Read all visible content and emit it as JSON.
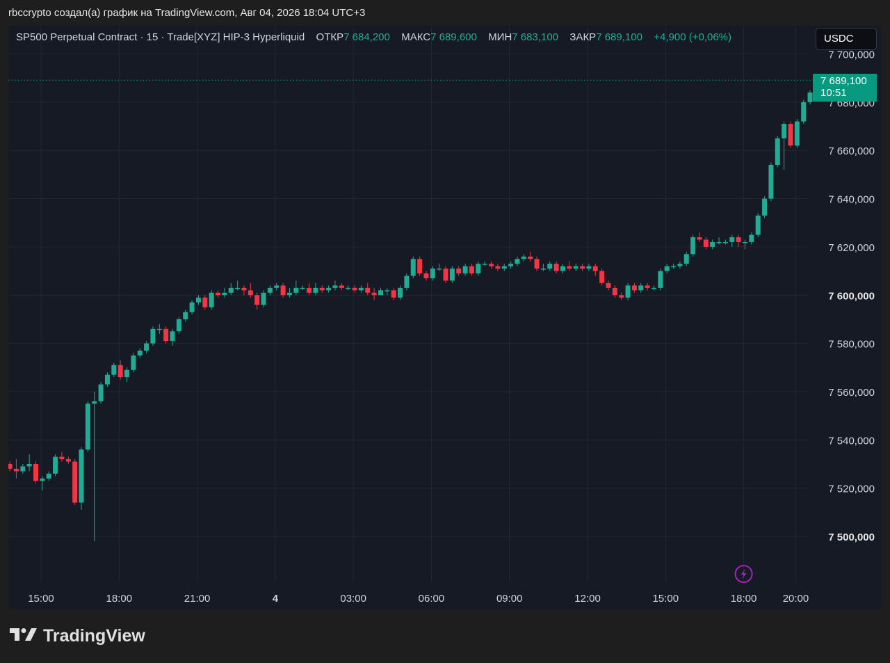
{
  "header": {
    "publisher_line": "rbccrypto создал(а) график на TradingView.com, Авг 04, 2026 18:04 UTC+3"
  },
  "legend": {
    "symbol": "SP500 Perpetual Contract · 15 · Trade[XYZ] HIP-3 Hyperliquid",
    "open_label": "ОТКР",
    "open_value": "7 684,200",
    "high_label": "МАКС",
    "high_value": "7 689,600",
    "low_label": "МИН",
    "low_value": "7 683,100",
    "close_label": "ЗАКР",
    "close_value": "7 689,100",
    "change": "+4,900 (+0,06%)"
  },
  "currency_button": {
    "label": "USDC"
  },
  "price_tag": {
    "price": "7 689,100",
    "countdown": "10:51"
  },
  "brand": {
    "name": "TradingView"
  },
  "colors": {
    "up": "#22ab94",
    "down": "#f23645",
    "background": "#161a25",
    "grid": "#232734",
    "tag": "#089981",
    "lightning": "#9c27b0"
  },
  "icons": {
    "lightning": "lightning-icon",
    "logo": "tradingview-logo-icon"
  },
  "chart_data": {
    "type": "candlestick",
    "title": "SP500 Perpetual Contract · 15 · Trade[XYZ] HIP-3 Hyperliquid",
    "interval": "15",
    "current_price": 7689.1,
    "ylim": [
      7487,
      7707
    ],
    "y_ticks": [
      {
        "value": 7700,
        "label": "7 700,000",
        "bold": false
      },
      {
        "value": 7680,
        "label": "7 680,000",
        "bold": false
      },
      {
        "value": 7660,
        "label": "7 660,000",
        "bold": false
      },
      {
        "value": 7640,
        "label": "7 640,000",
        "bold": false
      },
      {
        "value": 7620,
        "label": "7 620,000",
        "bold": false
      },
      {
        "value": 7600,
        "label": "7 600,000",
        "bold": true
      },
      {
        "value": 7580,
        "label": "7 580,000",
        "bold": false
      },
      {
        "value": 7560,
        "label": "7 560,000",
        "bold": false
      },
      {
        "value": 7540,
        "label": "7 540,000",
        "bold": false
      },
      {
        "value": 7520,
        "label": "7 520,000",
        "bold": false
      },
      {
        "value": 7500,
        "label": "7 500,000",
        "bold": true
      }
    ],
    "x_range_hours": [
      13.78,
      20.33
    ],
    "x_ticks": [
      {
        "hour": 15,
        "label": "15:00",
        "bold": false
      },
      {
        "hour": 18,
        "label": "18:00",
        "bold": false
      },
      {
        "hour": 21,
        "label": "21:00",
        "bold": false
      },
      {
        "hour": 24,
        "label": "4",
        "bold": true
      },
      {
        "hour": 27,
        "label": "03:00",
        "bold": false
      },
      {
        "hour": 30,
        "label": "06:00",
        "bold": false
      },
      {
        "hour": 33,
        "label": "09:00",
        "bold": false
      },
      {
        "hour": 36,
        "label": "12:00",
        "bold": false
      },
      {
        "hour": 39,
        "label": "15:00",
        "bold": false
      },
      {
        "hour": 42,
        "label": "18:00",
        "bold": false
      },
      {
        "hour": 44,
        "label": "20:00",
        "bold": false
      }
    ],
    "grid": true,
    "candles": [
      [
        7530,
        7528,
        7531,
        7527
      ],
      [
        7528,
        7527,
        7532,
        7524
      ],
      [
        7527,
        7529,
        7530,
        7526
      ],
      [
        7529,
        7530,
        7534,
        7527
      ],
      [
        7530,
        7523,
        7531,
        7522
      ],
      [
        7523,
        7524,
        7525,
        7519
      ],
      [
        7524,
        7526,
        7527,
        7523
      ],
      [
        7526,
        7533,
        7534,
        7525
      ],
      [
        7533,
        7532,
        7535,
        7531
      ],
      [
        7532,
        7531,
        7533,
        7530
      ],
      [
        7531,
        7514,
        7532,
        7513
      ],
      [
        7514,
        7536,
        7537,
        7511
      ],
      [
        7536,
        7555,
        7556,
        7535
      ],
      [
        7555,
        7556,
        7560,
        7498
      ],
      [
        7556,
        7563,
        7564,
        7555
      ],
      [
        7563,
        7567,
        7568,
        7562
      ],
      [
        7567,
        7571,
        7572,
        7566
      ],
      [
        7571,
        7566,
        7573,
        7565
      ],
      [
        7566,
        7569,
        7570,
        7564
      ],
      [
        7569,
        7575,
        7576,
        7568
      ],
      [
        7575,
        7577,
        7578,
        7574
      ],
      [
        7577,
        7580,
        7581,
        7576
      ],
      [
        7580,
        7586,
        7587,
        7579
      ],
      [
        7586,
        7586,
        7588,
        7584
      ],
      [
        7586,
        7581,
        7587,
        7580
      ],
      [
        7581,
        7585,
        7586,
        7579
      ],
      [
        7585,
        7590,
        7591,
        7584
      ],
      [
        7590,
        7593,
        7594,
        7589
      ],
      [
        7593,
        7597,
        7598,
        7592
      ],
      [
        7597,
        7599,
        7600,
        7596
      ],
      [
        7599,
        7595,
        7600,
        7594
      ],
      [
        7595,
        7601,
        7602,
        7594
      ],
      [
        7601,
        7600,
        7602,
        7599
      ],
      [
        7600,
        7601,
        7603,
        7599
      ],
      [
        7601,
        7603,
        7605,
        7600
      ],
      [
        7603,
        7603,
        7606,
        7602
      ],
      [
        7603,
        7602,
        7604,
        7600
      ],
      [
        7602,
        7600,
        7605,
        7599
      ],
      [
        7600,
        7596,
        7601,
        7594
      ],
      [
        7596,
        7601,
        7602,
        7595
      ],
      [
        7601,
        7603,
        7604,
        7600
      ],
      [
        7603,
        7604,
        7605,
        7602
      ],
      [
        7604,
        7600,
        7605,
        7599
      ],
      [
        7600,
        7601,
        7603,
        7599
      ],
      [
        7601,
        7603,
        7606,
        7600
      ],
      [
        7603,
        7603,
        7604,
        7602
      ],
      [
        7603,
        7601,
        7605,
        7600
      ],
      [
        7601,
        7603,
        7605,
        7600
      ],
      [
        7603,
        7602,
        7604,
        7601
      ],
      [
        7602,
        7603,
        7604,
        7601
      ],
      [
        7603,
        7604,
        7606,
        7602
      ],
      [
        7604,
        7603,
        7605,
        7602
      ],
      [
        7603,
        7603,
        7604,
        7602
      ],
      [
        7603,
        7602,
        7604,
        7601
      ],
      [
        7602,
        7603,
        7604,
        7601
      ],
      [
        7603,
        7601,
        7605,
        7600
      ],
      [
        7601,
        7600,
        7603,
        7598
      ],
      [
        7600,
        7602,
        7603,
        7600
      ],
      [
        7602,
        7602,
        7603,
        7600
      ],
      [
        7602,
        7599,
        7603,
        7598
      ],
      [
        7599,
        7603,
        7604,
        7598
      ],
      [
        7603,
        7608,
        7609,
        7602
      ],
      [
        7608,
        7615,
        7616,
        7607
      ],
      [
        7615,
        7609,
        7616,
        7608
      ],
      [
        7609,
        7607,
        7610,
        7606
      ],
      [
        7607,
        7611,
        7612,
        7606
      ],
      [
        7611,
        7611,
        7613,
        7610
      ],
      [
        7611,
        7606,
        7612,
        7605
      ],
      [
        7606,
        7611,
        7612,
        7605
      ],
      [
        7611,
        7609,
        7612,
        7608
      ],
      [
        7609,
        7612,
        7613,
        7608
      ],
      [
        7612,
        7609,
        7613,
        7608
      ],
      [
        7609,
        7613,
        7614,
        7608
      ],
      [
        7613,
        7613,
        7614,
        7612
      ],
      [
        7613,
        7612,
        7614,
        7611
      ],
      [
        7612,
        7611,
        7613,
        7610
      ],
      [
        7611,
        7612,
        7613,
        7610
      ],
      [
        7612,
        7613,
        7614,
        7611
      ],
      [
        7613,
        7615,
        7616,
        7612
      ],
      [
        7615,
        7616,
        7617,
        7614
      ],
      [
        7616,
        7615,
        7618,
        7614
      ],
      [
        7615,
        7611,
        7616,
        7610
      ],
      [
        7611,
        7611,
        7613,
        7610
      ],
      [
        7611,
        7613,
        7614,
        7610
      ],
      [
        7613,
        7610,
        7614,
        7609
      ],
      [
        7610,
        7612,
        7613,
        7609
      ],
      [
        7612,
        7611,
        7614,
        7610
      ],
      [
        7611,
        7612,
        7613,
        7610
      ],
      [
        7612,
        7611,
        7613,
        7610
      ],
      [
        7611,
        7612,
        7613,
        7610
      ],
      [
        7612,
        7610,
        7613,
        7608
      ],
      [
        7610,
        7605,
        7611,
        7604
      ],
      [
        7605,
        7603,
        7606,
        7602
      ],
      [
        7603,
        7600,
        7604,
        7599
      ],
      [
        7600,
        7599,
        7601,
        7598
      ],
      [
        7599,
        7604,
        7605,
        7598
      ],
      [
        7604,
        7602,
        7605,
        7601
      ],
      [
        7602,
        7604,
        7605,
        7601
      ],
      [
        7604,
        7603,
        7605,
        7602
      ],
      [
        7603,
        7603,
        7604,
        7602
      ],
      [
        7603,
        7610,
        7611,
        7602
      ],
      [
        7610,
        7612,
        7613,
        7609
      ],
      [
        7612,
        7612,
        7613,
        7611
      ],
      [
        7612,
        7613,
        7614,
        7611
      ],
      [
        7613,
        7617,
        7618,
        7612
      ],
      [
        7617,
        7624,
        7625,
        7616
      ],
      [
        7624,
        7623,
        7626,
        7622
      ],
      [
        7623,
        7620,
        7624,
        7619
      ],
      [
        7620,
        7622,
        7623,
        7619
      ],
      [
        7622,
        7622,
        7624,
        7621
      ],
      [
        7622,
        7622,
        7623,
        7621
      ],
      [
        7622,
        7624,
        7625,
        7620
      ],
      [
        7624,
        7622,
        7625,
        7620
      ],
      [
        7622,
        7622,
        7623,
        7619
      ],
      [
        7622,
        7625,
        7626,
        7621
      ],
      [
        7625,
        7633,
        7634,
        7624
      ],
      [
        7633,
        7640,
        7641,
        7632
      ],
      [
        7640,
        7654,
        7655,
        7639
      ],
      [
        7654,
        7665,
        7666,
        7653
      ],
      [
        7665,
        7671,
        7672,
        7652
      ],
      [
        7671,
        7662,
        7672,
        7661
      ],
      [
        7662,
        7672,
        7673,
        7661
      ],
      [
        7672,
        7680,
        7681,
        7671
      ],
      [
        7680,
        7684,
        7685,
        7679
      ],
      [
        7684,
        7689,
        7690,
        7683
      ]
    ]
  }
}
